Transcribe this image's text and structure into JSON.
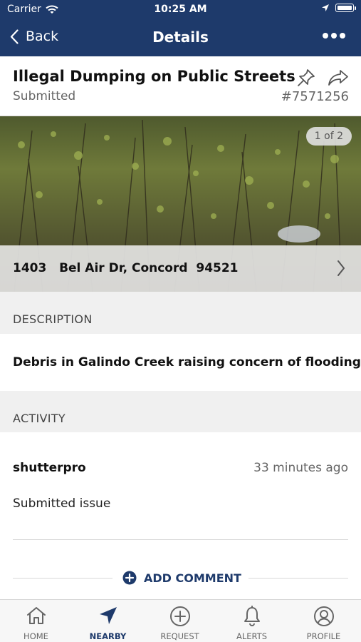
{
  "status_bar": {
    "carrier": "Carrier",
    "time": "10:25 AM"
  },
  "nav": {
    "back_label": "Back",
    "title": "Details"
  },
  "issue": {
    "title": "Illegal Dumping on Public Streets",
    "status": "Submitted",
    "id": "#7571256"
  },
  "photo": {
    "counter": "1 of 2",
    "address": "1403   Bel Air Dr, Concord  94521"
  },
  "description": {
    "header": "DESCRIPTION",
    "text": "Debris in Galindo Creek raising concern of flooding"
  },
  "activity": {
    "header": "ACTIVITY",
    "user": "shutterpro",
    "time_ago": "33 minutes ago",
    "action": "Submitted issue",
    "add_comment_label": "ADD COMMENT"
  },
  "tabs": [
    {
      "label": "HOME",
      "icon": "home-icon"
    },
    {
      "label": "NEARBY",
      "icon": "nearby-arrow-icon"
    },
    {
      "label": "REQUEST",
      "icon": "plus-circle-icon"
    },
    {
      "label": "ALERTS",
      "icon": "bell-icon"
    },
    {
      "label": "PROFILE",
      "icon": "profile-icon"
    }
  ],
  "colors": {
    "brand": "#1e3a6b",
    "section_bg": "#f0f0f0",
    "muted_text": "#666666"
  }
}
